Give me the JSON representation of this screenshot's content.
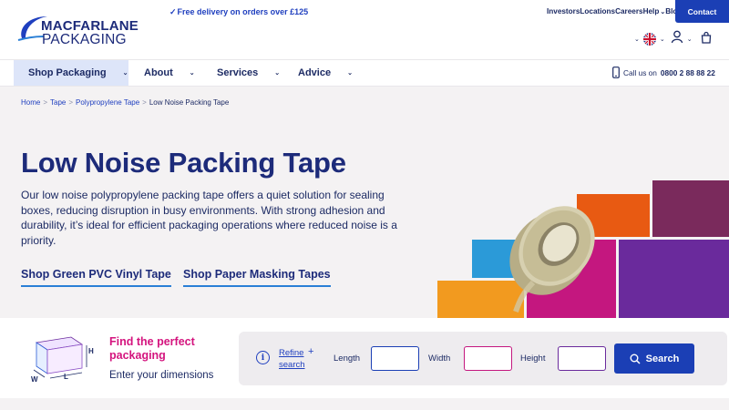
{
  "header": {
    "logo_line1": "MACFARLANE",
    "logo_line2": "PACKAGING",
    "promo_tick": "✓",
    "promo_text": "Free delivery on orders over £125",
    "top_links": [
      "Investors",
      "Locations",
      "Careers",
      "Help",
      "Blog"
    ],
    "help_chevron": "⌄",
    "contact_label": "Contact",
    "icons": [
      "flag-uk-icon",
      "user-icon",
      "basket-icon"
    ]
  },
  "nav": {
    "items": [
      {
        "label": "Shop Packaging",
        "active": true
      },
      {
        "label": "About",
        "active": false
      },
      {
        "label": "Services",
        "active": false
      },
      {
        "label": "Advice",
        "active": false
      }
    ],
    "call_text": "Call us on",
    "call_number": "0800 2 88 88 22"
  },
  "breadcrumb": {
    "items": [
      "Home",
      "Tape",
      "Polypropylene Tape"
    ],
    "current": "Low Noise Packing Tape",
    "separator": ">"
  },
  "hero": {
    "title": "Low Noise Packing Tape",
    "description": "Our low noise polypropylene packing tape offers a quiet solution for sealing boxes, reducing disruption in busy environments. With strong adhesion and durability, it’s ideal for efficient packaging operations where reduced noise is a priority.",
    "links": [
      "Shop Green PVC Vinyl Tape",
      "Shop Paper Masking Tapes"
    ],
    "block_colors": [
      "#f29a1f",
      "#2b9ad8",
      "#c4177f",
      "#e85a12",
      "#7a2a5c",
      "#6a2a9c"
    ]
  },
  "finder": {
    "heading": "Find the perfect packaging",
    "subheading": "Enter your dimensions",
    "box_labels": {
      "h": "H",
      "w": "W",
      "l": "L"
    },
    "refine_label": "Refine search",
    "refine_plus": "+",
    "length_label": "Length",
    "width_label": "Width",
    "height_label": "Height",
    "length_value": "",
    "width_value": "",
    "height_value": "",
    "search_label": "Search",
    "colors": {
      "length_border": "#1b3fb5",
      "width_border": "#c4177f",
      "height_border": "#6a2a9c"
    }
  }
}
